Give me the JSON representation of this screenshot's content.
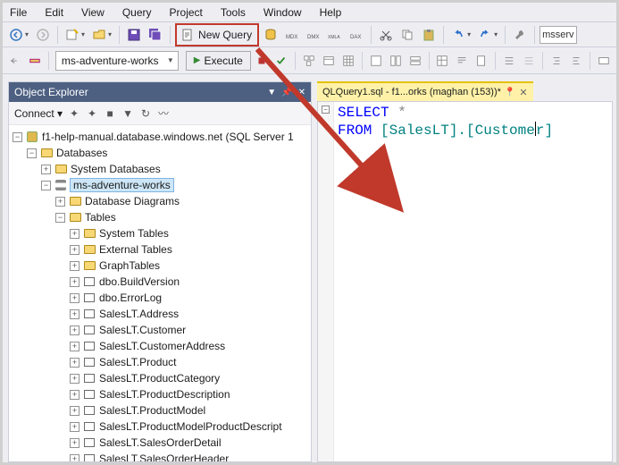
{
  "menu": [
    "File",
    "Edit",
    "View",
    "Query",
    "Project",
    "Tools",
    "Window",
    "Help"
  ],
  "toolbar1": {
    "newquery_label": "New Query",
    "server_hint": "msservi"
  },
  "toolbar2": {
    "db_selected": "ms-adventure-works",
    "execute_label": "Execute"
  },
  "objectExplorer": {
    "title": "Object Explorer",
    "connect_label": "Connect",
    "root": "f1-help-manual.database.windows.net (SQL Server 1",
    "nodes": {
      "databases": "Databases",
      "sysdb": "System Databases",
      "userdb": "ms-adventure-works",
      "dbdiag": "Database Diagrams",
      "tables": "Tables",
      "systables": "System Tables",
      "exttables": "External Tables",
      "graphtables": "GraphTables",
      "t1": "dbo.BuildVersion",
      "t2": "dbo.ErrorLog",
      "t3": "SalesLT.Address",
      "t4": "SalesLT.Customer",
      "t5": "SalesLT.CustomerAddress",
      "t6": "SalesLT.Product",
      "t7": "SalesLT.ProductCategory",
      "t8": "SalesLT.ProductDescription",
      "t9": "SalesLT.ProductModel",
      "t10": "SalesLT.ProductModelProductDescript",
      "t11": "SalesLT.SalesOrderDetail",
      "t12": "SalesLT.SalesOrderHeader"
    }
  },
  "editor": {
    "tab_label": "QLQuery1.sql - f1...orks (maghan (153))*",
    "sql_select": "SELECT",
    "sql_star": "*",
    "sql_from": "FROM",
    "sql_obj": "[SalesLT].[Custome",
    "sql_obj_tail": "r]"
  }
}
